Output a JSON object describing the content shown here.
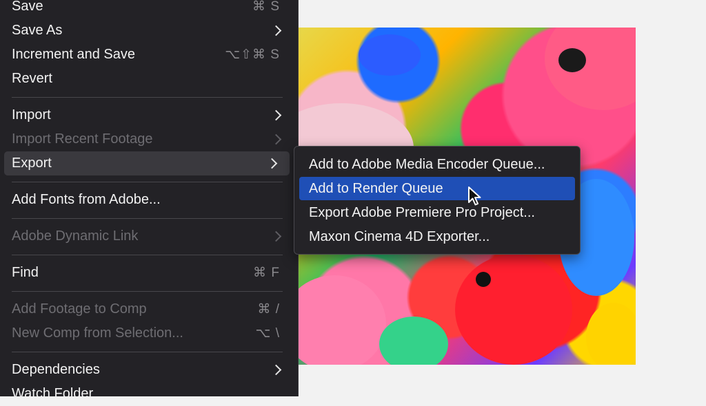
{
  "file_menu": {
    "items": [
      {
        "label": "Save",
        "shortcut": "⌘ S"
      },
      {
        "label": "Save As"
      },
      {
        "label": "Increment and Save",
        "shortcut": "⌥⇧⌘ S"
      },
      {
        "label": "Revert"
      },
      {
        "label": "Import"
      },
      {
        "label": "Import Recent Footage"
      },
      {
        "label": "Export"
      },
      {
        "label": "Add Fonts from Adobe..."
      },
      {
        "label": "Adobe Dynamic Link"
      },
      {
        "label": "Find",
        "shortcut": "⌘ F"
      },
      {
        "label": "Add Footage to Comp",
        "shortcut": "⌘ /"
      },
      {
        "label": "New Comp from Selection...",
        "shortcut": "⌥ \\"
      },
      {
        "label": "Dependencies"
      },
      {
        "label": "Watch Folder"
      }
    ]
  },
  "export_submenu": {
    "items": [
      {
        "label": "Add to Adobe Media Encoder Queue..."
      },
      {
        "label": "Add to Render Queue"
      },
      {
        "label": "Export Adobe Premiere Pro Project..."
      },
      {
        "label": "Maxon Cinema 4D Exporter..."
      }
    ],
    "selected_label": "Add to Render Queue"
  },
  "icons": {
    "submenu_arrow": "chevron-right-icon",
    "cursor": "mouse-pointer-icon"
  },
  "colors": {
    "menu_bg": "#232226",
    "selection": "#1f4fb6",
    "disabled_text": "#6e6d72"
  }
}
